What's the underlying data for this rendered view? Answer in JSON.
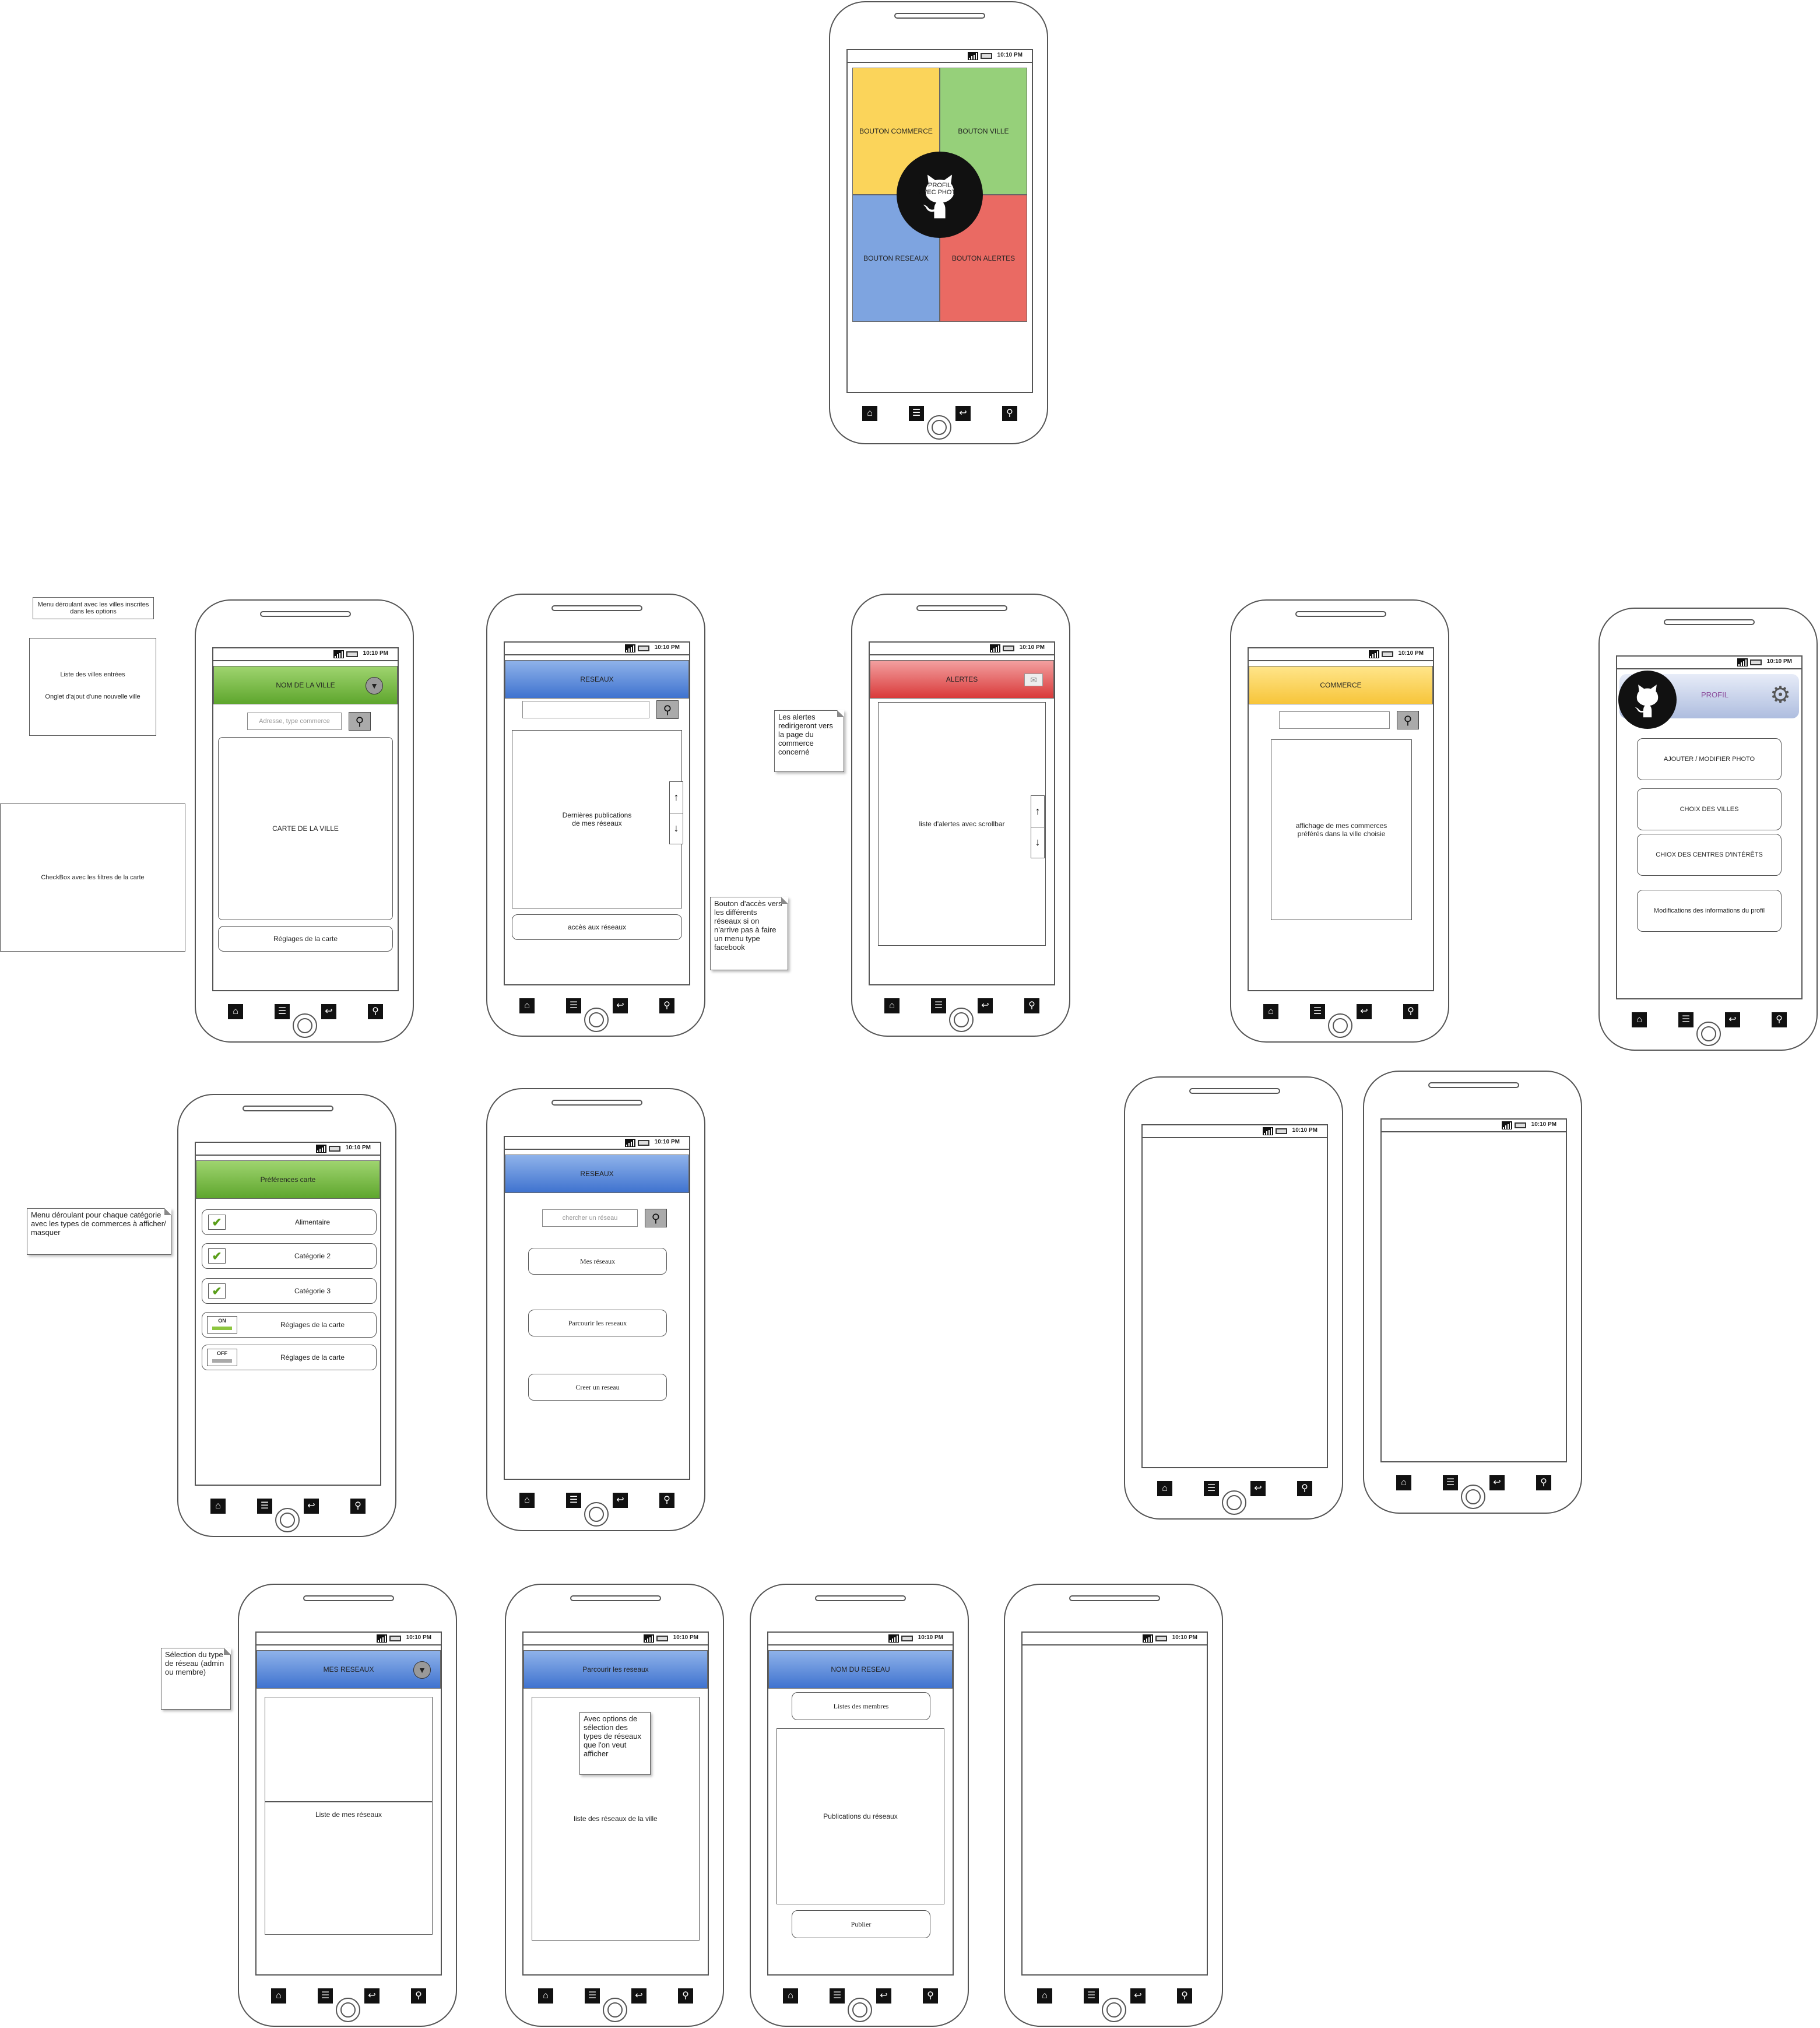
{
  "status_time": "10:10 PM",
  "nav_icons": [
    "home-icon",
    "menu-icon",
    "back-icon",
    "search-icon"
  ],
  "colors": {
    "green": "#6cb33e",
    "blue": "#4a7fd6",
    "red": "#e34646",
    "yellow": "#fbd45a",
    "lightblue": "#7ea4e0",
    "lightgreen": "#96d07a"
  },
  "home": {
    "tiles": {
      "commerce": "BOUTON COMMERCE",
      "ville": "BOUTON VILLE",
      "reseaux": "BOUTON RESEAUX",
      "alertes": "BOUTON ALERTES"
    },
    "profile_line1": "PROFIL",
    "profile_line2": "AVEC PHOTO"
  },
  "ville": {
    "title": "NOM DE LA VILLE",
    "search_placeholder": "Adresse, type commerce",
    "map_label": "CARTE DE LA VILLE",
    "settings_button": "Réglages de la carte"
  },
  "reseaux": {
    "title": "RESEAUX",
    "feed_line1": "Dernières publications",
    "feed_line2": "de mes réseaux",
    "access_button": "accès aux réseaux"
  },
  "alertes": {
    "title": "ALERTES",
    "list_label": "liste d'alertes avec scrollbar"
  },
  "commerce": {
    "title": "COMMERCE",
    "list_line1": "affichage de mes commerces",
    "list_line2": "préférés dans la ville choisie"
  },
  "profil": {
    "title": "PROFIL",
    "buttons": [
      "AJOUTER / MODIFIER PHOTO",
      "CHOIX DES VILLES",
      "CHIOX DES CENTRES D'INTÉRÊTS",
      "Modifications des informations du profil"
    ]
  },
  "preferences": {
    "title": "Préférences carte",
    "rows": [
      "Alimentaire",
      "Catégorie 2",
      "Catégorie 3",
      "Réglages de la carte",
      "Réglages de la carte"
    ],
    "toggle_on": "ON",
    "toggle_off": "OFF"
  },
  "reseaux_menu": {
    "title": "RESEAUX",
    "search_placeholder": "chercher un réseau",
    "buttons": [
      "Mes réseaux",
      "Parcourir les reseaux",
      "Creer un reseau"
    ]
  },
  "mes_reseaux": {
    "title": "MES RESEAUX",
    "list_label": "Liste de mes réseaux"
  },
  "parcourir": {
    "title": "Parcourir les reseaux",
    "options_note": "Avec options de sélection des types de réseaux que l'on veut afficher",
    "list_label": "liste des réseaux de la ville"
  },
  "nom_reseau": {
    "title": "NOM DU RESEAU",
    "members_button": "Listes des membres",
    "posts_label": "Publications du réseaux",
    "publish_button": "Publier"
  },
  "notes": {
    "menu_villes": "Menu déroulant avec les villes inscrites dans les options",
    "liste_villes_1": "Liste des villes entrées",
    "liste_villes_2": "Onglet d'ajout d'une nouvelle ville",
    "checkbox": "CheckBox avec les filtres de la carte",
    "alertes": "Les alertes redirigeront vers la page du commerce concerné",
    "bouton_acces": "Bouton d'accès vers les différents réseaux si on n'arrive pas à faire un menu type facebook",
    "menu_categorie": "Menu déroulant pour chaque catégorie avec les types de commerces à afficher/ masquer",
    "selection_type": "Sélection du type de réseau (admin ou membre)"
  }
}
